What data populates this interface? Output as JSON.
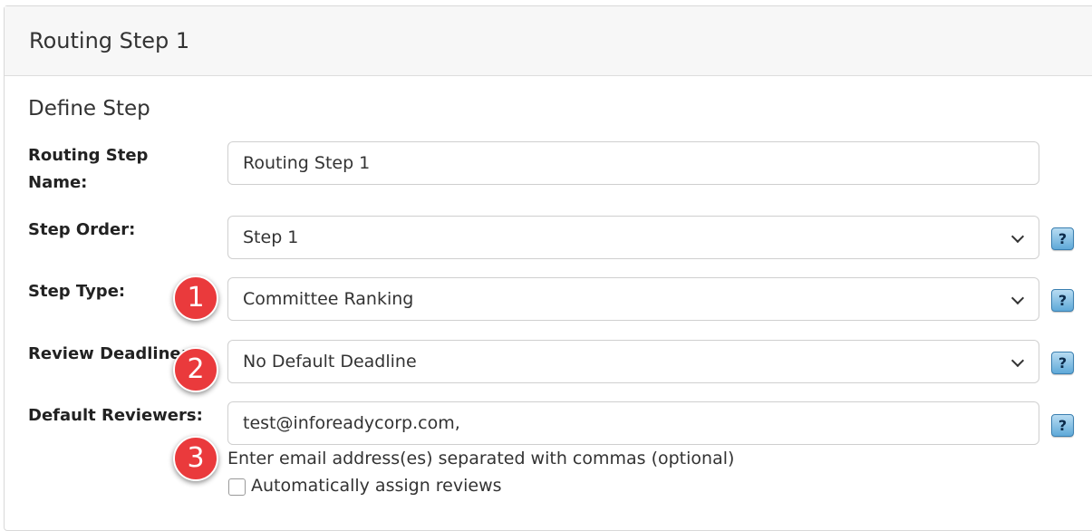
{
  "panel": {
    "title": "Routing Step 1"
  },
  "section": {
    "title": "Define Step"
  },
  "fields": {
    "step_name": {
      "label_line1": "Routing Step",
      "label_line2": "Name:",
      "value": "Routing Step 1"
    },
    "step_order": {
      "label": "Step Order:",
      "value": "Step 1"
    },
    "step_type": {
      "label": "Step Type:",
      "value": "Committee Ranking"
    },
    "review_deadline": {
      "label": "Review Deadline:",
      "value": "No Default Deadline"
    },
    "default_reviewers": {
      "label": "Default Reviewers:",
      "value": "test@inforeadycorp.com,",
      "hint": "Enter email address(es) separated with commas (optional)",
      "auto_assign_label": "Automatically assign reviews",
      "auto_assign_checked": false
    }
  },
  "help_icon_text": "?",
  "badges": [
    "1",
    "2",
    "3"
  ],
  "colors": {
    "badge": "#ea3a3c",
    "help_icon": "#5fa9d8"
  }
}
